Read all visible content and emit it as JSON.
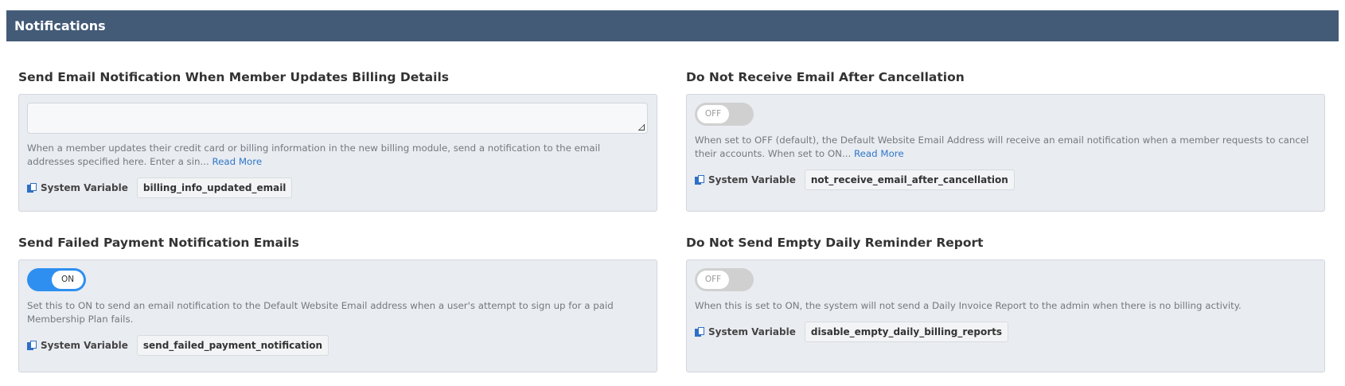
{
  "header": {
    "title": "Notifications"
  },
  "settings": [
    {
      "title": "Send Email Notification When Member Updates Billing Details",
      "control": "textarea",
      "value": "",
      "description": "When a member updates their credit card or billing information in the new billing module, send a notification to the email addresses specified here. Enter a sin...",
      "read_more": "Read More",
      "sysvar_label": "System Variable",
      "sysvar_value": "billing_info_updated_email"
    },
    {
      "title": "Do Not Receive Email After Cancellation",
      "control": "toggle",
      "toggle_state": "OFF",
      "description": "When set to OFF (default), the Default Website Email Address will receive an email notification when a member requests to cancel their accounts.  When set to ON...",
      "read_more": "Read More",
      "sysvar_label": "System Variable",
      "sysvar_value": "not_receive_email_after_cancellation"
    },
    {
      "title": "Send Failed Payment Notification Emails",
      "control": "toggle",
      "toggle_state": "ON",
      "description": "Set this to ON to send an email notification to the Default Website Email address when a user's attempt to sign up for a paid Membership Plan fails.",
      "sysvar_label": "System Variable",
      "sysvar_value": "send_failed_payment_notification"
    },
    {
      "title": "Do Not Send Empty Daily Reminder Report",
      "control": "toggle",
      "toggle_state": "OFF",
      "description": "When this is set to ON, the system will not send a Daily Invoice Report to the admin when there is no billing activity.",
      "sysvar_label": "System Variable",
      "sysvar_value": "disable_empty_daily_billing_reports"
    }
  ],
  "colors": {
    "header_bg": "#435b77",
    "toggle_on": "#2e8ff0",
    "toggle_off": "#d0d0d0",
    "link": "#2f77c8"
  },
  "icons": {
    "sysvar": "copy-icon"
  }
}
